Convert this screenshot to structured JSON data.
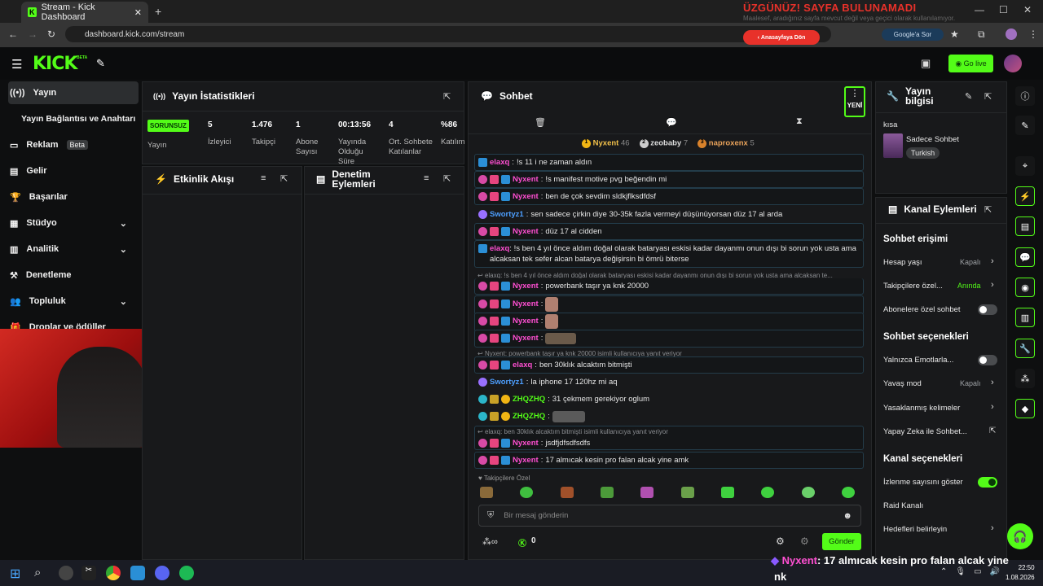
{
  "browser": {
    "tab_title": "Stream - Kick Dashboard",
    "url": "dashboard.kick.com/stream",
    "google_label": "Google'a Sor",
    "notfound_title": "ÜZGÜNÜZ! SAYFA BULUNAMADI",
    "notfound_sub": "Maalesef, aradığınız sayfa mevcut değil veya geçici olarak kullanılamıyor.",
    "home_button": "Anasayfaya Dön"
  },
  "topbar": {
    "logo": "KICK",
    "logo_badge": "BETA",
    "go_live": "Go live"
  },
  "sidebar": {
    "items": [
      {
        "label": "Yayın",
        "icon": "broadcast-icon"
      },
      {
        "label": "Yayın Bağlantısı ve Anahtarı"
      },
      {
        "label": "Reklam",
        "badge": "Beta",
        "icon": "ad-icon"
      },
      {
        "label": "Gelir",
        "icon": "revenue-icon"
      },
      {
        "label": "Başarılar",
        "icon": "trophy-icon"
      },
      {
        "label": "Stüdyo",
        "icon": "studio-icon"
      },
      {
        "label": "Analitik",
        "icon": "analytics-icon"
      },
      {
        "label": "Denetleme",
        "icon": "moderation-icon"
      },
      {
        "label": "Topluluk",
        "icon": "community-icon"
      },
      {
        "label": "Droplar ve ödüller",
        "icon": "gift-icon"
      }
    ]
  },
  "stats": {
    "title": "Yayın İstatistikleri",
    "status": "SORUNSUZ",
    "status_label": "Yayın",
    "items": [
      {
        "value": "5",
        "label": "İzleyici"
      },
      {
        "value": "1.476",
        "label": "Takipçi"
      },
      {
        "value": "1",
        "label": "Abone Sayısı"
      },
      {
        "value": "00:13:56",
        "label": "Yayında Olduğu Süre"
      },
      {
        "value": "4",
        "label": "Ort. Sohbete Katılanlar"
      },
      {
        "value": "%86",
        "label": "Katılım"
      }
    ]
  },
  "activity": {
    "title": "Etkinlik Akışı"
  },
  "modlog": {
    "title": "Denetim Eylemleri"
  },
  "chat": {
    "title": "Sohbet",
    "new_label": "YENİ",
    "leaders": [
      {
        "name": "Nyxent",
        "count": "46",
        "rank": "1"
      },
      {
        "name": "zeobaby",
        "count": "7",
        "rank": "2"
      },
      {
        "name": "naproxenx",
        "count": "5",
        "rank": "3"
      }
    ],
    "messages": [
      {
        "user": "elaxq",
        "text": "!s 11 i ne zaman aldın"
      },
      {
        "user": "Nyxent",
        "text": "!s manifest motive pvg beğendin mi"
      },
      {
        "user": "Nyxent",
        "text": "ben de çok sevdim sldkjflksdfdsf"
      },
      {
        "user": "Swortyz1",
        "text": "sen sadece çirkin diye 30-35k fazla vermeyi düşünüyorsan düz 17 al arda"
      },
      {
        "user": "Nyxent",
        "text": "düz 17 al cidden"
      },
      {
        "user": "elaxq",
        "text": "!s ben 4 yıl önce aldım doğal olarak bataryası eskisi kadar dayanmı onun dışı bi sorun yok usta ama alcaksan tek sefer alcan batarya değişirsin bi ömrü biterse"
      },
      {
        "reply": "elaxq: !s ben 4 yıl önce aldım doğal olarak bataryası eskisi kadar dayanmı onun dışı bi sorun yok usta ama alcaksan te...",
        "user": "Nyxent",
        "text": "powerbank taşır ya knk 20000"
      },
      {
        "user": "Nyxent",
        "text": ""
      },
      {
        "user": "Nyxent",
        "text": ""
      },
      {
        "user": "Nyxent",
        "text": ""
      },
      {
        "reply": "Nyxent: powerbank taşır ya knk 20000 isimli kullanıcıya yanıt veriyor",
        "user": "elaxq",
        "text": "ben 30klık alcaktım bitmişti"
      },
      {
        "user": "Swortyz1",
        "text": "la iphone 17 120hz mi aq"
      },
      {
        "user": "ZHQZHQ",
        "text": "31 çekmem gerekiyor oglum"
      },
      {
        "user": "ZHQZHQ",
        "text": ""
      },
      {
        "reply": "elaxq: ben 30klık alcaktım bitmişti isimli kullanıcıya yanıt veriyor",
        "user": "Nyxent",
        "text": "jsdfjdfsdfsdfs"
      },
      {
        "user": "Nyxent",
        "text": "17 almıcak kesin pro falan alcak yine amk"
      }
    ],
    "followers_only": "Takipçilere Özel",
    "input_placeholder": "Bir mesaj gönderin",
    "points": "0",
    "send": "Gönder"
  },
  "stream_info": {
    "title": "Yayın bilgisi",
    "stream_title": "kısa",
    "category": "Sadece Sohbet",
    "tag": "Turkish"
  },
  "channel_actions": {
    "title": "Kanal Eylemleri",
    "chat_access": "Sohbet erişimi",
    "account_age": "Hesap yaşı",
    "account_age_val": "Kapalı",
    "followers_only": "Takipçilere özel...",
    "followers_only_val": "Anında",
    "subs_only": "Abonelere özel sohbet",
    "chat_options": "Sohbet seçenekleri",
    "emotes_only": "Yalnızca Emotlarla...",
    "slow_mode": "Yavaş mod",
    "slow_mode_val": "Kapalı",
    "banned_words": "Yasaklanmış kelimeler",
    "ai_chat": "Yapay Zeka ile Sohbet...",
    "channel_options": "Kanal seçenekleri",
    "show_viewers": "İzlenme sayısını göster",
    "raid": "Raid Kanalı",
    "goals": "Hedefleri belirleyin"
  },
  "overlay": {
    "user": "Nyxent",
    "text": ": 17 almıcak kesin pro falan alcak yine",
    "cont": "nk"
  },
  "taskbar": {
    "time": "22:50",
    "date": "1.08.2026"
  }
}
